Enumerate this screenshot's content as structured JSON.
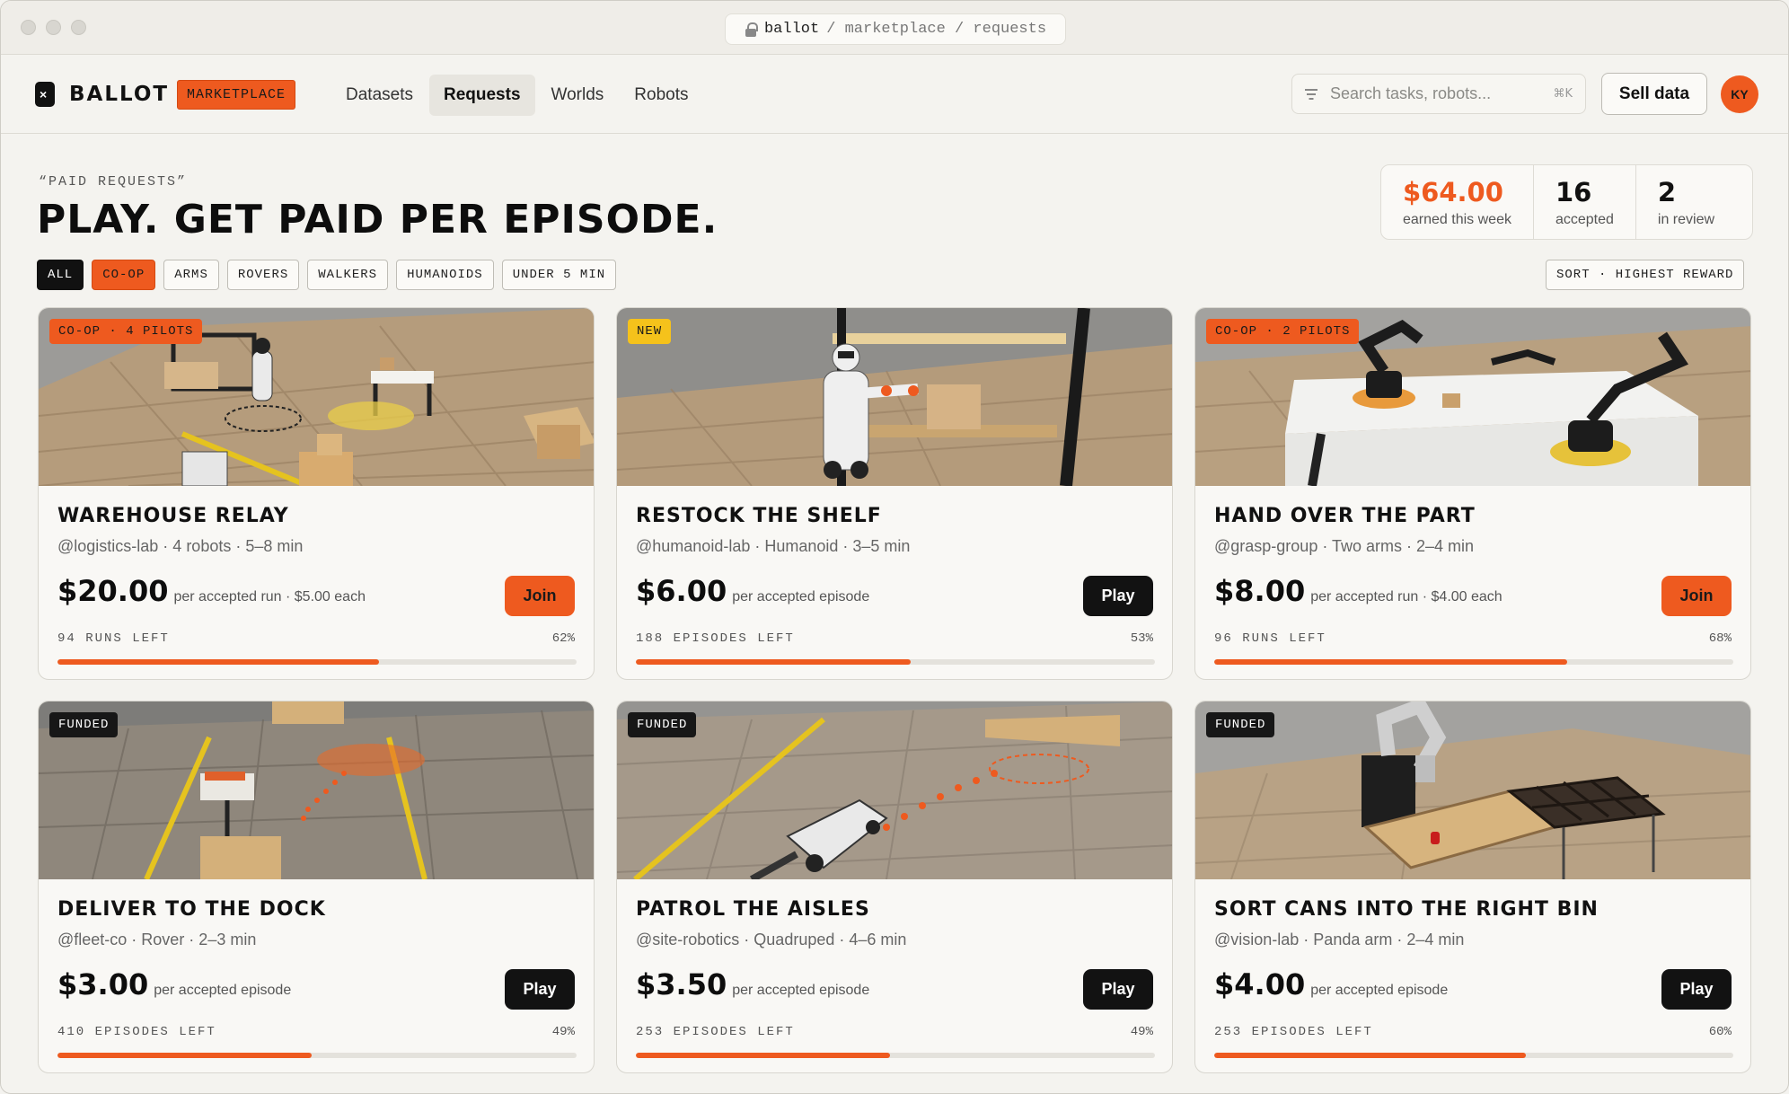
{
  "browser": {
    "url_host": "ballot",
    "url_path": "/ marketplace / requests"
  },
  "nav": {
    "brand": "BALLOT",
    "badge": "MARKETPLACE",
    "links": [
      "Datasets",
      "Requests",
      "Worlds",
      "Robots"
    ],
    "active_link": "Requests",
    "search_placeholder": "Search tasks, robots...",
    "search_shortcut": "⌘K",
    "sell_label": "Sell data",
    "avatar_initials": "KY"
  },
  "header": {
    "eyebrow": "“PAID REQUESTS”",
    "headline": "PLAY. GET PAID PER EPISODE.",
    "stats": [
      {
        "value": "$64.00",
        "label": "earned this week"
      },
      {
        "value": "16",
        "label": "accepted"
      },
      {
        "value": "2",
        "label": "in review"
      }
    ]
  },
  "filters": {
    "chips": [
      "ALL",
      "CO-OP",
      "ARMS",
      "ROVERS",
      "WALKERS",
      "HUMANOIDS",
      "UNDER 5 MIN"
    ],
    "sort": "SORT · HIGHEST REWARD"
  },
  "cards": [
    {
      "tag": "CO-OP · 4 PILOTS",
      "tag_style": "orange",
      "title": "WAREHOUSE RELAY",
      "meta": "@logistics-lab · 4 robots · 5–8 min",
      "price": "$20.00",
      "price_note": "per accepted run · $5.00 each",
      "button": "Join",
      "remaining": "94 RUNS LEFT",
      "percent_label": "62%",
      "progress": 0.62
    },
    {
      "tag": "NEW",
      "tag_style": "yellow",
      "title": "RESTOCK THE SHELF",
      "meta": "@humanoid-lab · Humanoid · 3–5 min",
      "price": "$6.00",
      "price_note": "per accepted episode",
      "button": "Play",
      "remaining": "188 EPISODES LEFT",
      "percent_label": "53%",
      "progress": 0.53
    },
    {
      "tag": "CO-OP · 2 PILOTS",
      "tag_style": "orange",
      "title": "HAND OVER THE PART",
      "meta": "@grasp-group · Two arms · 2–4 min",
      "price": "$8.00",
      "price_note": "per accepted run · $4.00 each",
      "button": "Join",
      "remaining": "96 RUNS LEFT",
      "percent_label": "68%",
      "progress": 0.68
    },
    {
      "tag": "FUNDED",
      "tag_style": "dark",
      "title": "DELIVER TO THE DOCK",
      "meta": "@fleet-co · Rover · 2–3 min",
      "price": "$3.00",
      "price_note": "per accepted episode",
      "button": "Play",
      "remaining": "410 EPISODES LEFT",
      "percent_label": "49%",
      "progress": 0.49
    },
    {
      "tag": "FUNDED",
      "tag_style": "dark",
      "title": "PATROL THE AISLES",
      "meta": "@site-robotics · Quadruped · 4–6 min",
      "price": "$3.50",
      "price_note": "per accepted episode",
      "button": "Play",
      "remaining": "253 EPISODES LEFT",
      "percent_label": "49%",
      "progress": 0.49
    },
    {
      "tag": "FUNDED",
      "tag_style": "dark",
      "title": "SORT CANS INTO THE RIGHT BIN",
      "meta": "@vision-lab · Panda arm · 2–4 min",
      "price": "$4.00",
      "price_note": "per accepted episode",
      "button": "Play",
      "remaining": "253 EPISODES LEFT",
      "percent_label": "60%",
      "progress": 0.6
    }
  ],
  "colors": {
    "accent": "#ee5a1f",
    "new_tag": "#f5c21b",
    "background": "#f4f3ef",
    "dark": "#121212"
  }
}
